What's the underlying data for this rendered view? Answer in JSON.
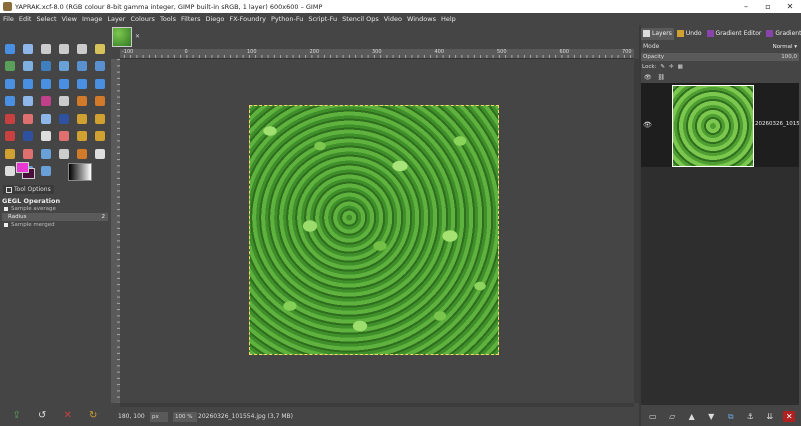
{
  "window": {
    "title": "YAPRAK.xcf-8.0 (RGB colour 8-bit gamma integer, GIMP built-in sRGB, 1 layer) 600x600 – GIMP"
  },
  "menu": [
    "File",
    "Edit",
    "Select",
    "View",
    "Image",
    "Layer",
    "Colours",
    "Tools",
    "Filters",
    "Diego",
    "FX-Foundry",
    "Python-Fu",
    "Script-Fu",
    "Stencil Ops",
    "Video",
    "Windows",
    "Help"
  ],
  "toolbox": {
    "tools": [
      {
        "icon": "move-icon",
        "color": "#4a90e2"
      },
      {
        "icon": "align-icon",
        "color": "#8fb6e8"
      },
      {
        "icon": "rect-select-icon",
        "color": "#cccccc"
      },
      {
        "icon": "ellipse-select-icon",
        "color": "#cccccc"
      },
      {
        "icon": "free-select-icon",
        "color": "#cccccc"
      },
      {
        "icon": "fuzzy-select-icon",
        "color": "#d6c15a"
      },
      {
        "icon": "select-by-color-icon",
        "color": "#5aa05a"
      },
      {
        "icon": "scissors-icon",
        "color": "#7fb0e0"
      },
      {
        "icon": "foreground-select-icon",
        "color": "#3f7fbf"
      },
      {
        "icon": "paths-icon",
        "color": "#6aa0d8"
      },
      {
        "icon": "color-picker-icon",
        "color": "#5a8fd0"
      },
      {
        "icon": "zoom-icon",
        "color": "#5a8fd0"
      },
      {
        "icon": "measure-icon",
        "color": "#4a90e2"
      },
      {
        "icon": "crop-icon",
        "color": "#4a90e2"
      },
      {
        "icon": "rotate-icon",
        "color": "#4a90e2"
      },
      {
        "icon": "scale-icon",
        "color": "#4a90e2"
      },
      {
        "icon": "shear-icon",
        "color": "#4a90e2"
      },
      {
        "icon": "perspective-icon",
        "color": "#4a90e2"
      },
      {
        "icon": "flip-icon",
        "color": "#4a90e2"
      },
      {
        "icon": "cage-icon",
        "color": "#8fb6e8"
      },
      {
        "icon": "warp-icon",
        "color": "#c0408a"
      },
      {
        "icon": "text-icon",
        "color": "#cccccc"
      },
      {
        "icon": "bucket-fill-icon",
        "color": "#d07a2a"
      },
      {
        "icon": "pencil-icon",
        "color": "#d07a2a"
      },
      {
        "icon": "paintbrush-icon",
        "color": "#c94040"
      },
      {
        "icon": "eraser-icon",
        "color": "#e07070"
      },
      {
        "icon": "airbrush-icon",
        "color": "#8fb6e8"
      },
      {
        "icon": "ink-icon",
        "color": "#3050a0"
      },
      {
        "icon": "mypaint-brush-icon",
        "color": "#d0a030"
      },
      {
        "icon": "clone-icon",
        "color": "#d0a030"
      },
      {
        "icon": "heal-icon",
        "color": "#c94040"
      },
      {
        "icon": "perspective-clone-icon",
        "color": "#3050a0"
      },
      {
        "icon": "blur-icon",
        "color": "#dddddd"
      },
      {
        "icon": "smudge-icon",
        "color": "#e07070"
      },
      {
        "icon": "dodge-burn-icon",
        "color": "#d0a030"
      },
      {
        "icon": "gradient-icon",
        "color": "#d0a030"
      },
      {
        "icon": "gegl-operation-icon",
        "color": "#d0a030"
      },
      {
        "icon": "handle-transform-icon",
        "color": "#e07070"
      },
      {
        "icon": "unified-transform-icon",
        "color": "#6aa0d8"
      },
      {
        "icon": "color-balance-icon",
        "color": "#cccccc"
      },
      {
        "icon": "threshold-icon",
        "color": "#d07a2a"
      },
      {
        "icon": "text-tool-icon",
        "color": "#dddddd"
      },
      {
        "icon": "pick-icon",
        "color": "#dddddd"
      },
      {
        "icon": "paths-tool-icon",
        "color": "#6aa0d8"
      },
      {
        "icon": "zoom-tool-icon",
        "color": "#6aa0d8"
      }
    ],
    "tool_options_tab": "Tool Options",
    "options_heading": "GEGL Operation",
    "sample_average": "Sample average",
    "radius_label": "Radius",
    "radius_value": "2",
    "sample_merged": "Sample merged"
  },
  "status": {
    "coords": "180, 100",
    "unit": "px",
    "zoom": "100 %",
    "file_info": "20260326_101554.jpg (3,7 MB)"
  },
  "ruler": {
    "labels": [
      "-100",
      "0",
      "100",
      "200",
      "300",
      "400",
      "500",
      "600",
      "700",
      "800"
    ]
  },
  "dock": {
    "tabs": [
      {
        "label": "Layers",
        "icon": "layers-icon",
        "color": "#dddddd"
      },
      {
        "label": "Undo",
        "icon": "undo-icon",
        "color": "#d0a030"
      },
      {
        "label": "Gradient Editor",
        "icon": "gradient-editor-icon",
        "color": "#8844aa"
      },
      {
        "label": "Gradients",
        "icon": "gradients-icon",
        "color": "#8844aa"
      }
    ],
    "mode_label": "Mode",
    "mode_value": "Normal",
    "opacity_label": "Opacity",
    "opacity_value": "100,0",
    "lock_label": "Lock:",
    "layer_name": "20260326_10155"
  }
}
